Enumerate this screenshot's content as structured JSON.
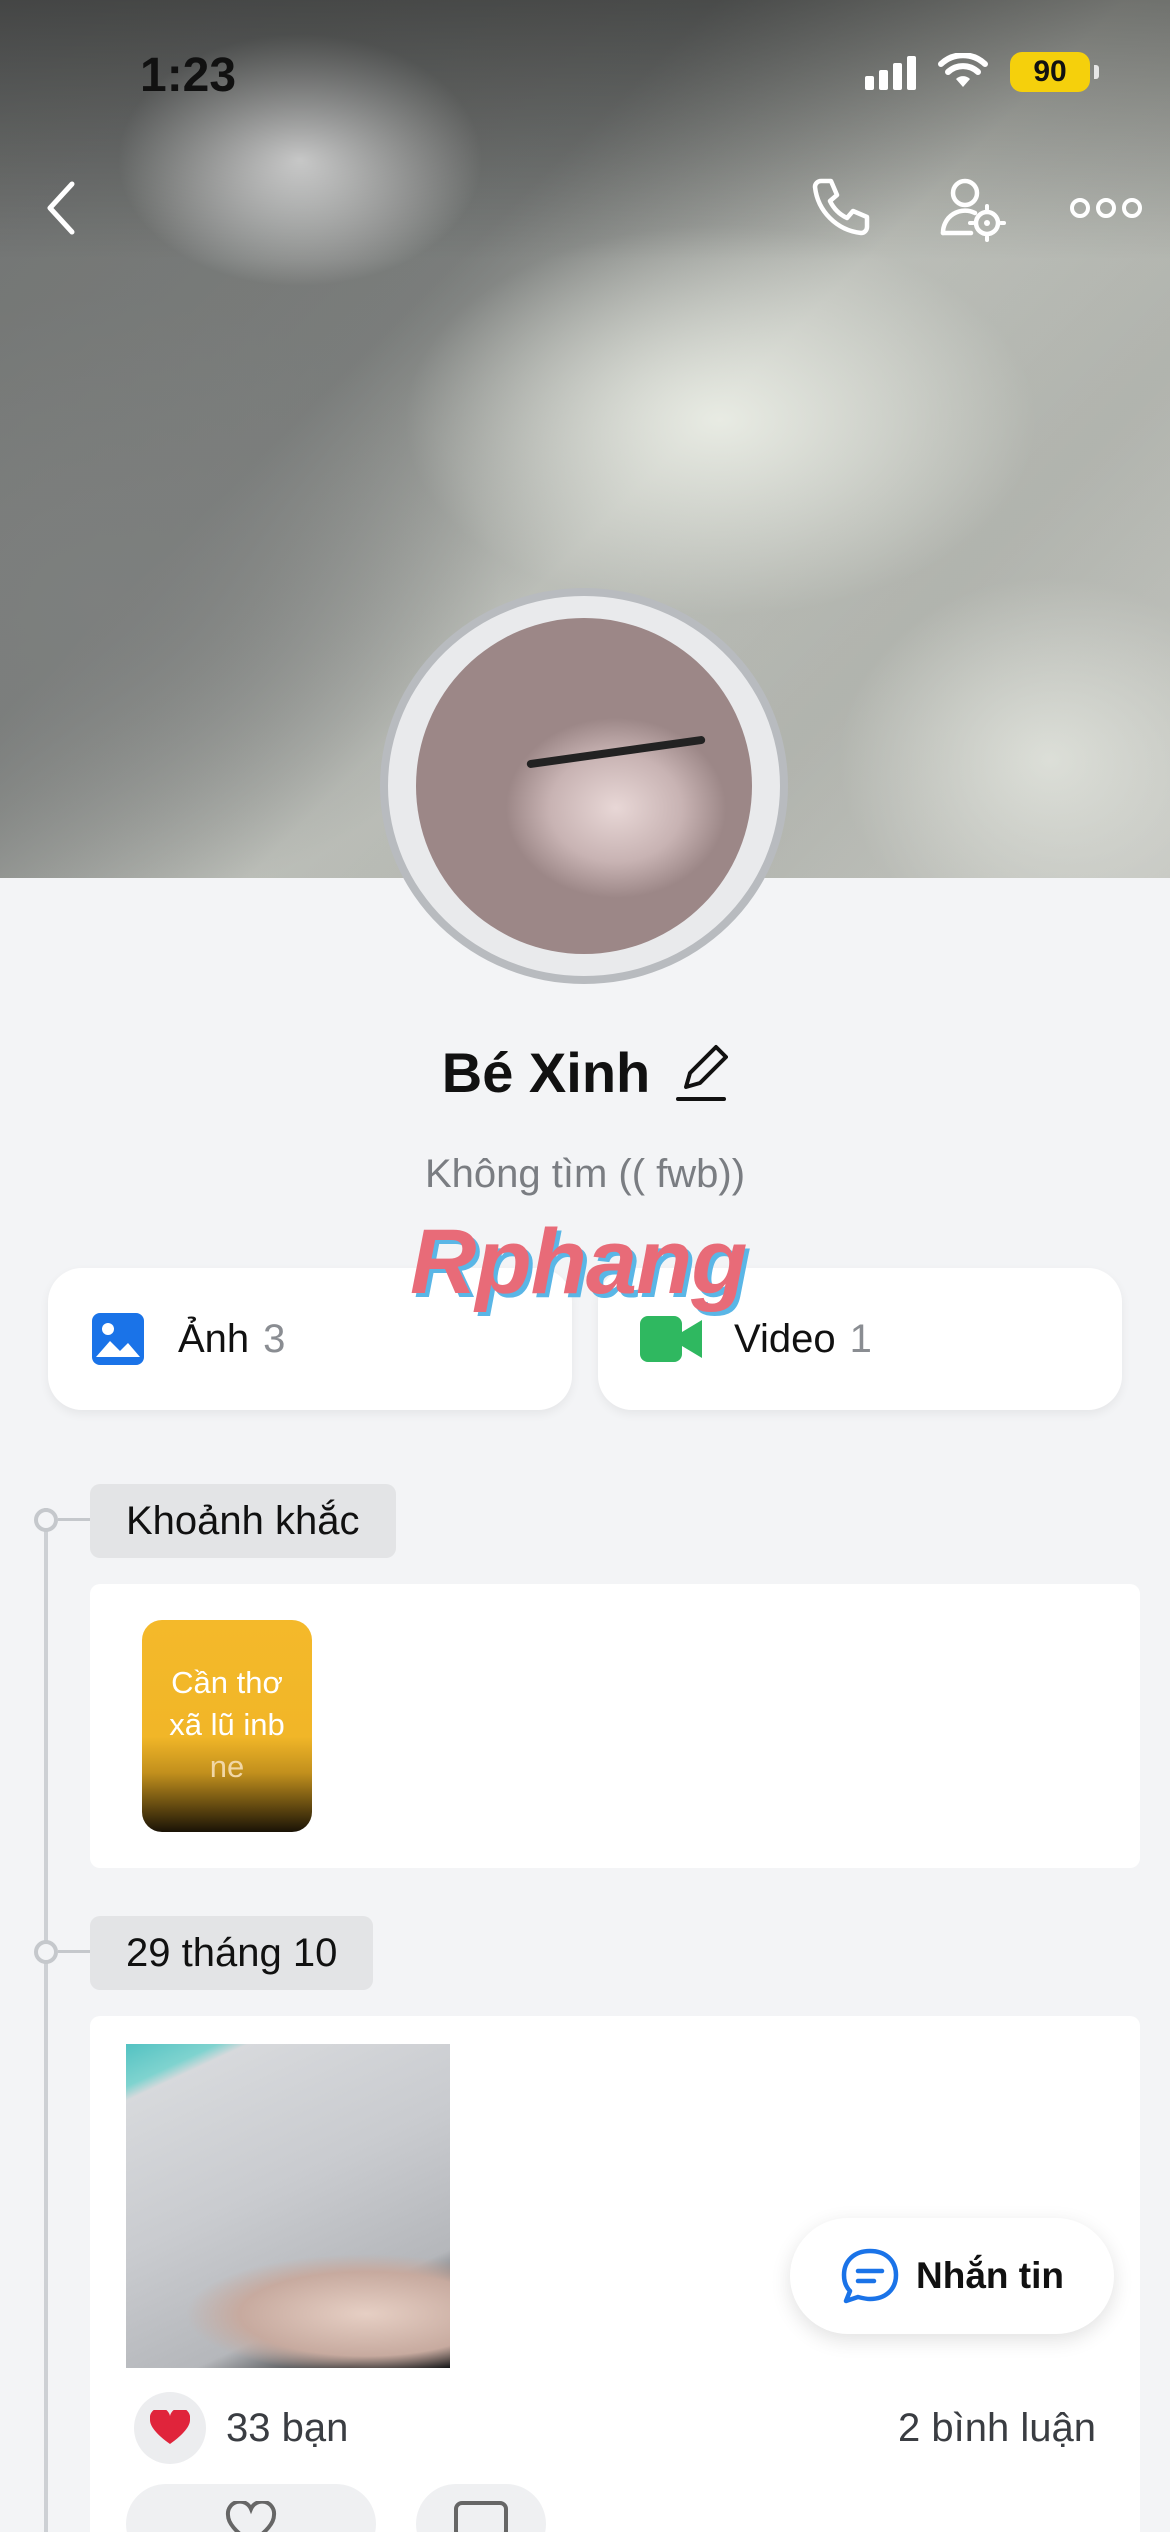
{
  "status_bar": {
    "time": "1:23",
    "battery": "90"
  },
  "profile": {
    "name": "Bé Xinh",
    "bio": "Không tìm (( fwb))",
    "watermark": "Rphang"
  },
  "media": {
    "photos": {
      "label": "Ảnh",
      "count": "3",
      "icon": "image-icon"
    },
    "videos": {
      "label": "Video",
      "count": "1",
      "icon": "video-camera-icon"
    }
  },
  "timeline": {
    "moments": {
      "title": "Khoảnh khắc",
      "story_text": [
        "Cần thơ",
        "xã lũ inb",
        "ne"
      ]
    },
    "post": {
      "date": "29 tháng 10",
      "reactions": "33 bạn",
      "comments": "2 bình luận"
    }
  },
  "message_button": {
    "label": "Nhắn tin"
  },
  "colors": {
    "accent": "#1a73e8",
    "video": "#2fb860",
    "heart": "#e0243b",
    "battery": "#f5d00c"
  }
}
